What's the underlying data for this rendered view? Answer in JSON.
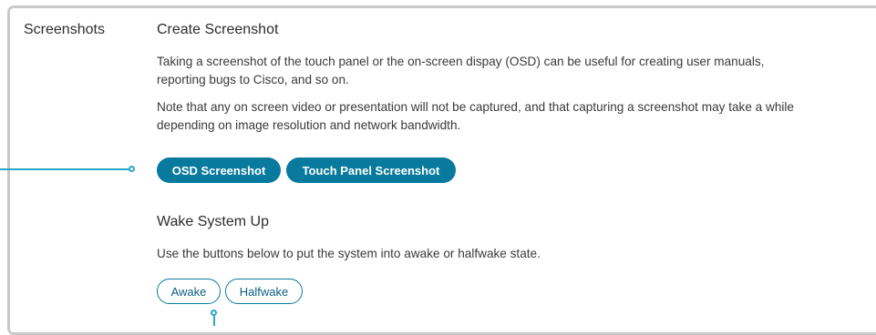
{
  "section": {
    "label": "Screenshots"
  },
  "create_screenshot": {
    "heading": "Create Screenshot",
    "description_lines": [
      "Taking a screenshot of the touch panel or the on-screen dispay (OSD) can be useful for creating user manuals,",
      "reporting bugs to Cisco, and so on."
    ],
    "note_lines": [
      "Note that any on screen video or presentation will not be captured, and that capturing a screenshot may take a while",
      "depending on image resolution and network bandwidth."
    ],
    "buttons": {
      "osd": "OSD Screenshot",
      "touch_panel": "Touch Panel Screenshot"
    }
  },
  "wake_system": {
    "heading": "Wake System Up",
    "description": "Use the buttons below to put the system into awake or halfwake state.",
    "buttons": {
      "awake": "Awake",
      "halfwake": "Halfwake"
    }
  },
  "colors": {
    "accent": "#077a9e",
    "callout": "#2aa7c7",
    "border": "#c9c9c9"
  }
}
